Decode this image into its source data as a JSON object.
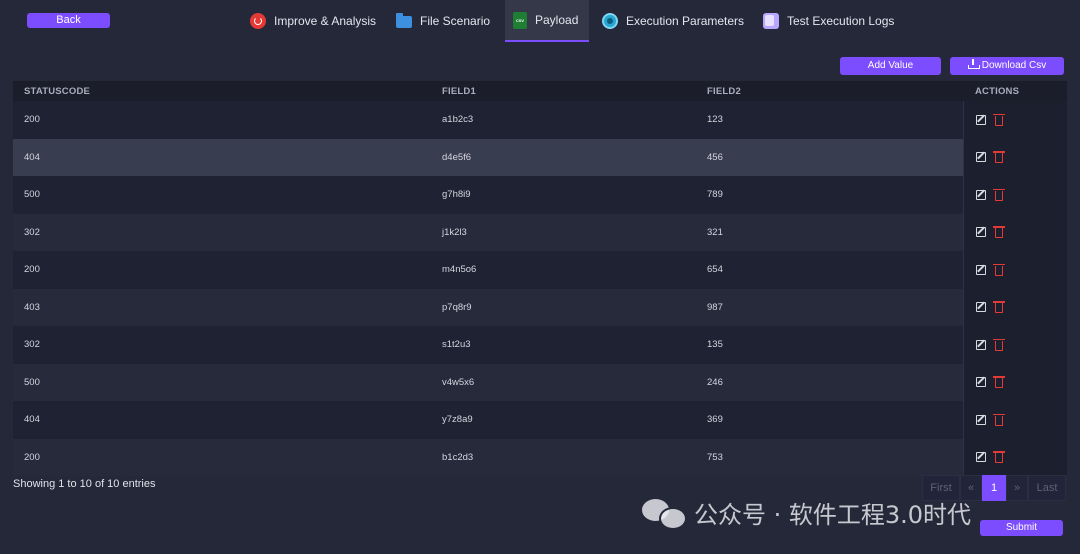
{
  "nav": {
    "back_label": "Back",
    "tabs": [
      {
        "label": "Improve & Analysis",
        "icon": "improve-icon"
      },
      {
        "label": "File Scenario",
        "icon": "folder-icon"
      },
      {
        "label": "Payload",
        "icon": "csv-file-icon",
        "active": true,
        "icon_text": "CSV"
      },
      {
        "label": "Execution Parameters",
        "icon": "gear-icon"
      },
      {
        "label": "Test Execution Logs",
        "icon": "logs-icon"
      }
    ]
  },
  "toolbar": {
    "add_value_label": "Add Value",
    "download_csv_label": "Download Csv"
  },
  "table": {
    "columns": [
      "STATUSCODE",
      "FIELD1",
      "FIELD2",
      "ACTIONS"
    ],
    "rows": [
      {
        "statuscode": "200",
        "field1": "a1b2c3",
        "field2": "123"
      },
      {
        "statuscode": "404",
        "field1": "d4e5f6",
        "field2": "456"
      },
      {
        "statuscode": "500",
        "field1": "g7h8i9",
        "field2": "789"
      },
      {
        "statuscode": "302",
        "field1": "j1k2l3",
        "field2": "321"
      },
      {
        "statuscode": "200",
        "field1": "m4n5o6",
        "field2": "654"
      },
      {
        "statuscode": "403",
        "field1": "p7q8r9",
        "field2": "987"
      },
      {
        "statuscode": "302",
        "field1": "s1t2u3",
        "field2": "135"
      },
      {
        "statuscode": "500",
        "field1": "v4w5x6",
        "field2": "246"
      },
      {
        "statuscode": "404",
        "field1": "y7z8a9",
        "field2": "369"
      },
      {
        "statuscode": "200",
        "field1": "b1c2d3",
        "field2": "753"
      }
    ]
  },
  "footer": {
    "info": "Showing 1 to 10 of 10 entries",
    "pagination": {
      "first": "First",
      "prev": "«",
      "current": "1",
      "next": "»",
      "last": "Last"
    },
    "submit_label": "Submit"
  },
  "watermark": {
    "text": "公众号 · 软件工程3.0时代"
  },
  "colors": {
    "accent": "#7c4dff",
    "background": "#252839",
    "danger": "#e53935"
  }
}
